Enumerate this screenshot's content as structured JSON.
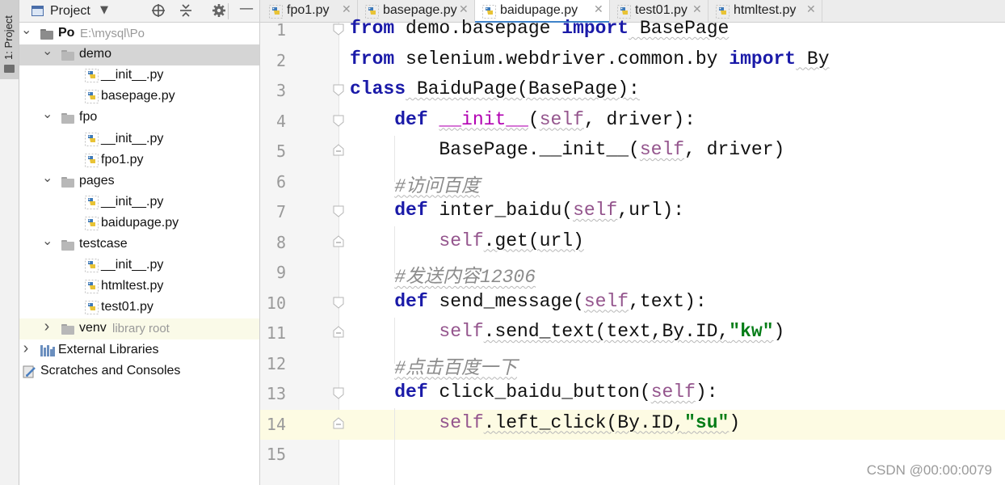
{
  "side_tool": {
    "project_tab_label": "1: Project"
  },
  "panel": {
    "title": "Project",
    "tree": [
      {
        "label": "Po",
        "sublabel": "E:\\mysql\\Po",
        "depth": 0,
        "kind": "root-folder",
        "expanded": true
      },
      {
        "label": "demo",
        "depth": 1,
        "kind": "folder",
        "expanded": true,
        "selected": true
      },
      {
        "label": "__init__.py",
        "depth": 2,
        "kind": "py"
      },
      {
        "label": "basepage.py",
        "depth": 2,
        "kind": "py"
      },
      {
        "label": "fpo",
        "depth": 1,
        "kind": "folder",
        "expanded": true
      },
      {
        "label": "__init__.py",
        "depth": 2,
        "kind": "py"
      },
      {
        "label": "fpo1.py",
        "depth": 2,
        "kind": "py"
      },
      {
        "label": "pages",
        "depth": 1,
        "kind": "folder",
        "expanded": true
      },
      {
        "label": "__init__.py",
        "depth": 2,
        "kind": "py"
      },
      {
        "label": "baidupage.py",
        "depth": 2,
        "kind": "py"
      },
      {
        "label": "testcase",
        "depth": 1,
        "kind": "folder",
        "expanded": true
      },
      {
        "label": "__init__.py",
        "depth": 2,
        "kind": "py"
      },
      {
        "label": "htmltest.py",
        "depth": 2,
        "kind": "py"
      },
      {
        "label": "test01.py",
        "depth": 2,
        "kind": "py"
      },
      {
        "label": "venv",
        "sublabel": "library root",
        "depth": 1,
        "kind": "folder",
        "expanded": false,
        "highlight": true
      },
      {
        "label": "External Libraries",
        "depth": 0,
        "kind": "libraries",
        "expanded": false
      },
      {
        "label": "Scratches and Consoles",
        "depth": 0,
        "kind": "scratches"
      }
    ]
  },
  "tabs": [
    {
      "label": "fpo1.py",
      "active": false
    },
    {
      "label": "basepage.py",
      "active": false
    },
    {
      "label": "baidupage.py",
      "active": true
    },
    {
      "label": "test01.py",
      "active": false
    },
    {
      "label": "htmltest.py",
      "active": false
    }
  ],
  "editor": {
    "current_line": 14,
    "lines": [
      {
        "n": "1",
        "tokens": [
          [
            "kw",
            "from"
          ],
          [
            "p",
            " demo.basepage "
          ],
          [
            "kw",
            "import"
          ],
          [
            "p",
            " BasePage"
          ]
        ]
      },
      {
        "n": "2",
        "tokens": [
          [
            "kw",
            "from"
          ],
          [
            "p",
            " selenium.webdriver.common.by "
          ],
          [
            "kw",
            "import"
          ],
          [
            "p",
            " By"
          ]
        ]
      },
      {
        "n": "3",
        "tokens": [
          [
            "kw",
            "class"
          ],
          [
            "p",
            " BaiduPage(BasePage):"
          ]
        ]
      },
      {
        "n": "4",
        "tokens": [
          [
            "p",
            "    "
          ],
          [
            "kw",
            "def"
          ],
          [
            "p",
            " "
          ],
          [
            "dunder",
            "__init__"
          ],
          [
            "p",
            "("
          ],
          [
            "self",
            "self"
          ],
          [
            "p",
            ", driver):"
          ]
        ]
      },
      {
        "n": "5",
        "tokens": [
          [
            "p",
            "        BasePage.__init__("
          ],
          [
            "self",
            "self"
          ],
          [
            "p",
            ", driver)"
          ]
        ]
      },
      {
        "n": "6",
        "tokens": [
          [
            "p",
            "    "
          ],
          [
            "cmt",
            "#访问百度"
          ]
        ]
      },
      {
        "n": "7",
        "tokens": [
          [
            "p",
            "    "
          ],
          [
            "kw",
            "def"
          ],
          [
            "p",
            " inter_baidu("
          ],
          [
            "self",
            "self"
          ],
          [
            "p",
            ",url):"
          ]
        ]
      },
      {
        "n": "8",
        "tokens": [
          [
            "p",
            "        "
          ],
          [
            "self",
            "self"
          ],
          [
            "p",
            ".get(url)"
          ]
        ]
      },
      {
        "n": "9",
        "tokens": [
          [
            "p",
            "    "
          ],
          [
            "cmt",
            "#发送内容12306"
          ]
        ]
      },
      {
        "n": "10",
        "tokens": [
          [
            "p",
            "    "
          ],
          [
            "kw",
            "def"
          ],
          [
            "p",
            " send_message("
          ],
          [
            "self",
            "self"
          ],
          [
            "p",
            ",text):"
          ]
        ]
      },
      {
        "n": "11",
        "tokens": [
          [
            "p",
            "        "
          ],
          [
            "self",
            "self"
          ],
          [
            "p",
            ".send_text(text,By.ID,"
          ],
          [
            "str",
            "\"kw\""
          ],
          [
            "p",
            ")"
          ]
        ]
      },
      {
        "n": "12",
        "tokens": [
          [
            "p",
            "    "
          ],
          [
            "cmt",
            "#点击百度一下"
          ]
        ]
      },
      {
        "n": "13",
        "tokens": [
          [
            "p",
            "    "
          ],
          [
            "kw",
            "def"
          ],
          [
            "p",
            " click_baidu_button("
          ],
          [
            "self",
            "self"
          ],
          [
            "p",
            "):"
          ]
        ]
      },
      {
        "n": "14",
        "tokens": [
          [
            "p",
            "        "
          ],
          [
            "self",
            "self"
          ],
          [
            "p",
            ".left_click(By.ID,"
          ],
          [
            "str",
            "\"su\""
          ],
          [
            "p",
            ")"
          ]
        ]
      },
      {
        "n": "15",
        "tokens": []
      }
    ]
  },
  "watermark": "CSDN @00:00:0079",
  "colors": {
    "accent": "#4083c9",
    "keyword": "#1a1aa8",
    "self": "#94558d",
    "string": "#067d17",
    "comment": "#8c8c8c",
    "current_line": "#fdfbe3"
  }
}
